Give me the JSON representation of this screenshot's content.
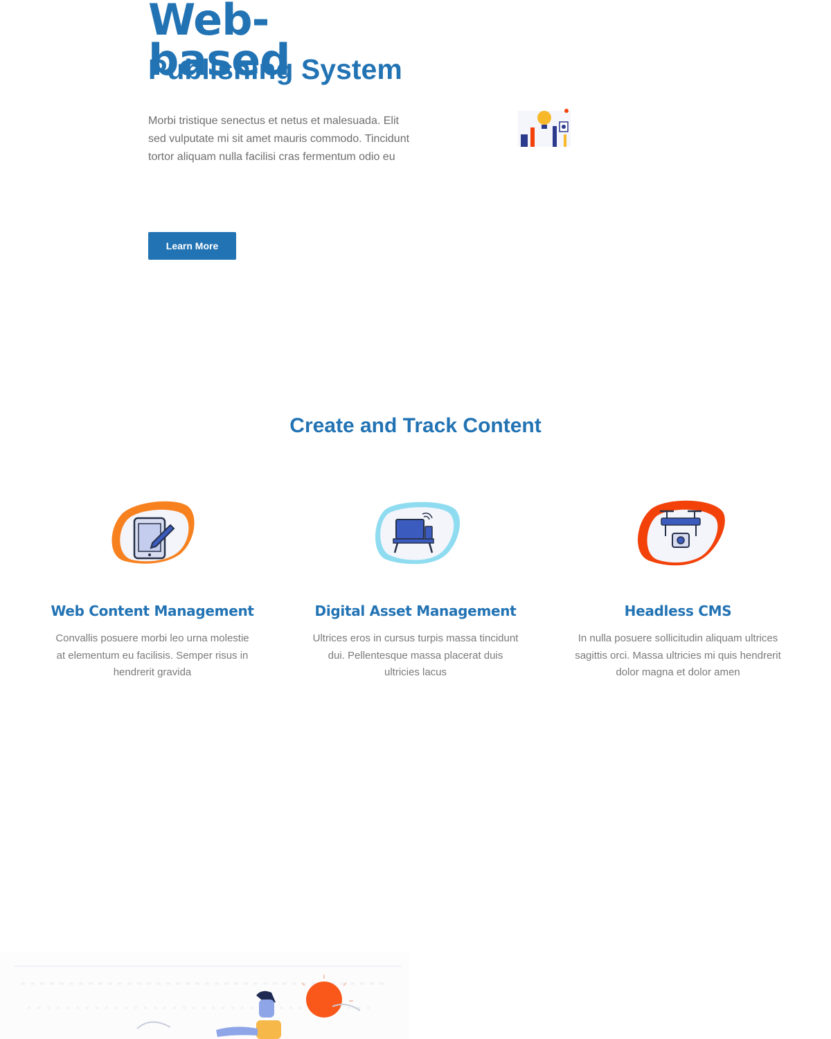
{
  "hero": {
    "title_main": "Web-based",
    "title_sub": "Publishing System",
    "text": "Morbi tristique senectus et netus et malesuada. Elit sed vulputate mi sit amet mauris commodo. Tincidunt tortor aliquam nulla facilisi cras fermentum odio eu",
    "button_label": "Learn More",
    "illustration": "team-lightbulb-illustration"
  },
  "section": {
    "title": "Create and Track Content",
    "features": [
      {
        "title": "Web Content Management",
        "text": "Convallis posuere morbi leo urna molestie at elementum eu facilisis. Semper risus in hendrerit gravida",
        "icon": "tablet-pen-icon",
        "blob_color": "#f7811f"
      },
      {
        "title": "Digital Asset Management",
        "text": "Ultrices eros in cursus turpis massa tincidunt dui. Pellentesque massa placerat duis ultricies lacus",
        "icon": "computer-desk-icon",
        "blob_color": "#8fdcf1"
      },
      {
        "title": "Headless CMS",
        "text": "In nulla posuere sollicitudin aliquam ultrices sagittis orci. Massa ultricies mi quis hendrerit dolor magna et dolor amen",
        "icon": "drone-camera-icon",
        "blob_color": "#f2420a"
      }
    ]
  },
  "bottom": {
    "illustration": "person-sun-illustration"
  },
  "colors": {
    "accent": "#2273b4",
    "body_text": "#6d6d6d"
  }
}
